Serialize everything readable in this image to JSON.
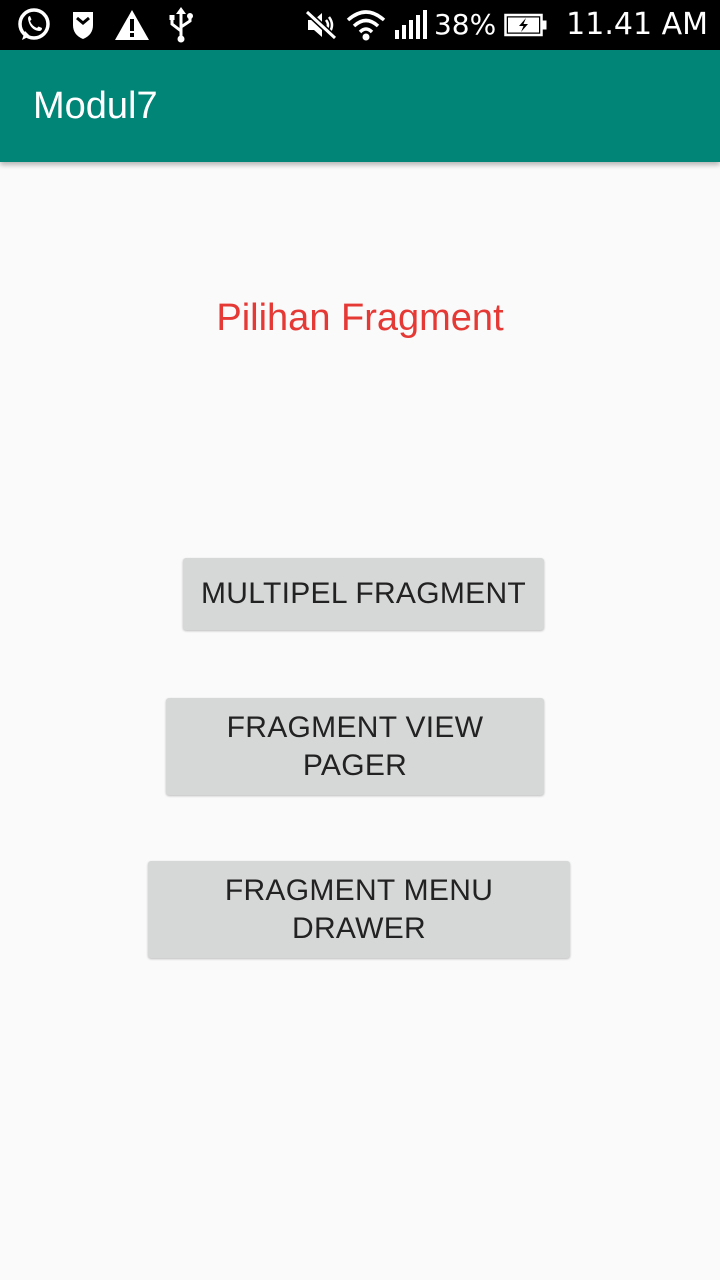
{
  "status_bar": {
    "left_icons": [
      "whatsapp-icon",
      "shield-icon",
      "warning-icon",
      "usb-icon"
    ],
    "right_icons": [
      "mute-icon",
      "wifi-icon",
      "signal-icon",
      "battery-charging-icon"
    ],
    "battery": "38%",
    "time": "11.41 AM"
  },
  "app_bar": {
    "title": "Modul7",
    "color": "#008577"
  },
  "main": {
    "heading": "Pilihan Fragment",
    "heading_color": "#e53935",
    "buttons": [
      {
        "label": "MULTIPEL FRAGMENT"
      },
      {
        "label": "FRAGMENT VIEW PAGER"
      },
      {
        "label": "FRAGMENT MENU DRAWER"
      }
    ]
  }
}
